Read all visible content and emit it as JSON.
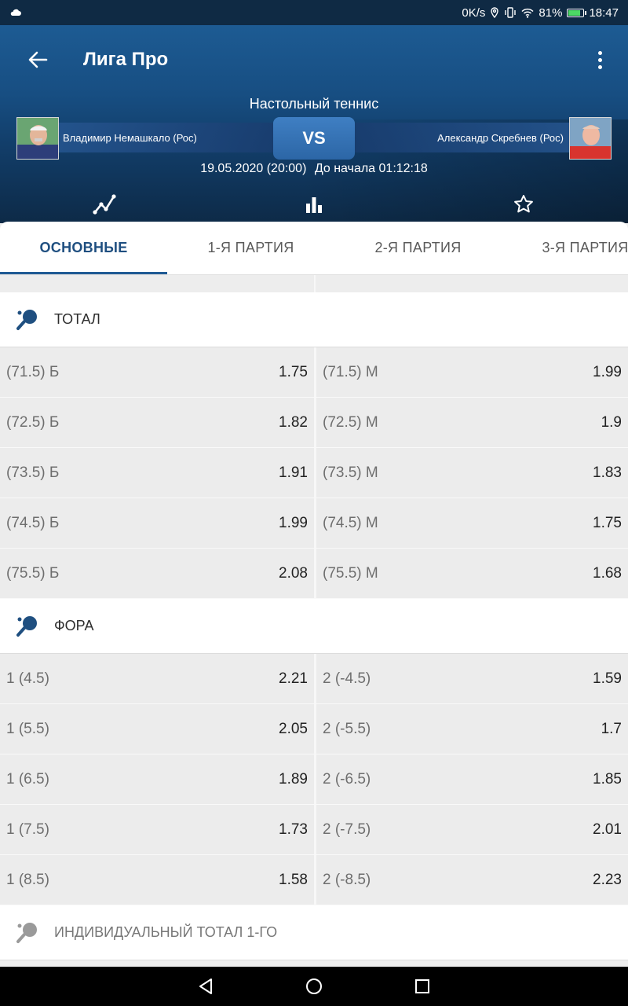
{
  "status_bar": {
    "speed": "0K/s",
    "battery": "81%",
    "time": "18:47",
    "battery_level": 0.81
  },
  "header": {
    "title": "Лига Про",
    "sport": "Настольный теннис",
    "player_left": "Владимир Немашкало (Рос)",
    "player_right": "Александр Скребнев (Рос)",
    "vs": "VS",
    "date": "19.05.2020 (20:00)",
    "countdown": "До начала 01:12:18"
  },
  "tabs": [
    {
      "label": "ОСНОВНЫЕ",
      "active": true
    },
    {
      "label": "1-Я ПАРТИЯ",
      "active": false
    },
    {
      "label": "2-Я ПАРТИЯ",
      "active": false
    },
    {
      "label": "3-Я ПАРТИЯ",
      "active": false
    }
  ],
  "total": {
    "title": "ТОТАЛ",
    "rows": [
      {
        "left_label": "(71.5) Б",
        "left_value": "1.75",
        "right_label": "(71.5) М",
        "right_value": "1.99"
      },
      {
        "left_label": "(72.5) Б",
        "left_value": "1.82",
        "right_label": "(72.5) М",
        "right_value": "1.9"
      },
      {
        "left_label": "(73.5) Б",
        "left_value": "1.91",
        "right_label": "(73.5) М",
        "right_value": "1.83"
      },
      {
        "left_label": "(74.5) Б",
        "left_value": "1.99",
        "right_label": "(74.5) М",
        "right_value": "1.75"
      },
      {
        "left_label": "(75.5) Б",
        "left_value": "2.08",
        "right_label": "(75.5) М",
        "right_value": "1.68"
      }
    ]
  },
  "handicap": {
    "title": "ФОРА",
    "rows": [
      {
        "left_label": "1 (4.5)",
        "left_value": "2.21",
        "right_label": "2 (-4.5)",
        "right_value": "1.59"
      },
      {
        "left_label": "1 (5.5)",
        "left_value": "2.05",
        "right_label": "2 (-5.5)",
        "right_value": "1.7"
      },
      {
        "left_label": "1 (6.5)",
        "left_value": "1.89",
        "right_label": "2 (-6.5)",
        "right_value": "1.85"
      },
      {
        "left_label": "1 (7.5)",
        "left_value": "1.73",
        "right_label": "2 (-7.5)",
        "right_value": "2.01"
      },
      {
        "left_label": "1 (8.5)",
        "left_value": "1.58",
        "right_label": "2 (-8.5)",
        "right_value": "2.23"
      }
    ]
  },
  "individual_total": {
    "title": "ИНДИВИДУАЛЬНЫЙ ТОТАЛ 1-ГО"
  },
  "colors": {
    "header_top": "#1d5b93",
    "header_bottom": "#0d2a47",
    "accent": "#1f5a94",
    "paddle_icon": "#1f4f80"
  }
}
